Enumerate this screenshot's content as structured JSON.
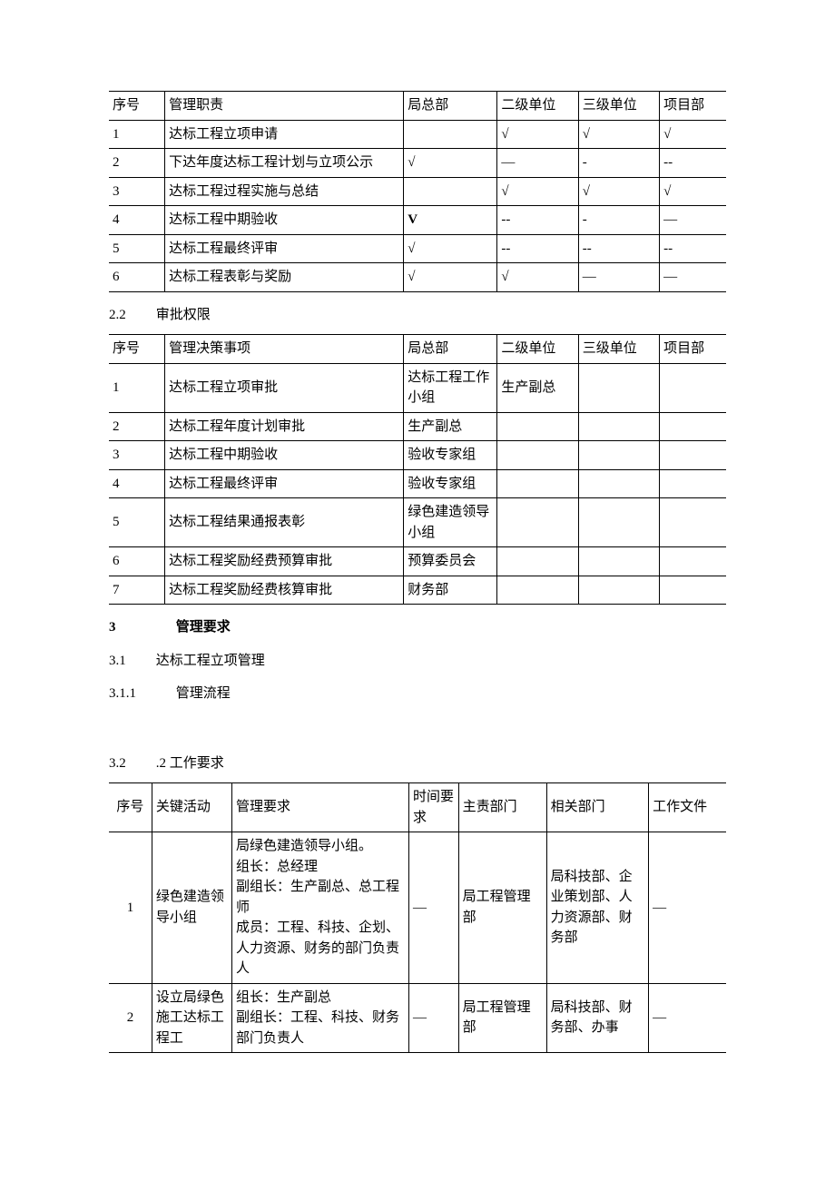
{
  "table1": {
    "headers": [
      "序号",
      "管理职责",
      "局总部",
      "二级单位",
      "三级单位",
      "项目部"
    ],
    "rows": [
      [
        "1",
        "达标工程立项申请",
        "",
        "√",
        "√",
        "√"
      ],
      [
        "2",
        "下达年度达标工程计划与立项公示",
        "√",
        "—",
        "-",
        "--"
      ],
      [
        "3",
        "达标工程过程实施与总结",
        "",
        "√",
        "√",
        "√"
      ],
      [
        "4",
        "达标工程中期验收",
        "V",
        "--",
        "-",
        "—"
      ],
      [
        "5",
        "达标工程最终评审",
        "√",
        "--",
        "--",
        "--"
      ],
      [
        "6",
        "达标工程表彰与奖励",
        "√",
        "√",
        "—",
        "—"
      ]
    ]
  },
  "sec22": {
    "num": "2.2",
    "title": "审批权限"
  },
  "table2": {
    "headers": [
      "序号",
      "管理决策事项",
      "局总部",
      "二级单位",
      "三级单位",
      "项目部"
    ],
    "rows": [
      [
        "1",
        "达标工程立项审批",
        "达标工程工作小组",
        "生产副总",
        "",
        ""
      ],
      [
        "2",
        "达标工程年度计划审批",
        "生产副总",
        "",
        "",
        ""
      ],
      [
        "3",
        "达标工程中期验收",
        "验收专家组",
        "",
        "",
        ""
      ],
      [
        "4",
        "达标工程最终评审",
        "验收专家组",
        "",
        "",
        ""
      ],
      [
        "5",
        "达标工程结果通报表彰",
        "绿色建造领导小组",
        "",
        "",
        ""
      ],
      [
        "6",
        "达标工程奖励经费预算审批",
        "预算委员会",
        "",
        "",
        ""
      ],
      [
        "7",
        "达标工程奖励经费核算审批",
        "财务部",
        "",
        "",
        ""
      ]
    ]
  },
  "sec3": {
    "num": "3",
    "title": "管理要求"
  },
  "sec31": {
    "num": "3.1",
    "title": "达标工程立项管理"
  },
  "sec311": {
    "num": "3.1.1",
    "title": "管理流程"
  },
  "sec32": {
    "num": "3.2",
    "title": ".2 工作要求"
  },
  "table3": {
    "headers": [
      "序号",
      "关键活动",
      "管理要求",
      "时间要求",
      "主责部门",
      "相关部门",
      "工作文件"
    ],
    "rows": [
      {
        "seq": "1",
        "activity": "绿色建造领导小组",
        "req": "局绿色建造领导小组。\n组长：总经理\n副组长：生产副总、总工程师\n成员：工程、科技、企划、人力资源、财务的部门负责人",
        "time": "—",
        "main": "局工程管理部",
        "rel": "局科技部、企业策划部、人力资源部、财务部",
        "file": "—"
      },
      {
        "seq": "2",
        "activity": "设立局绿色施工达标工程工",
        "req": "组长：生产副总\n副组长：工程、科技、财务部门负责人",
        "time": "—",
        "main": "局工程管理部",
        "rel": "局科技部、财务部、办事",
        "file": "—"
      }
    ]
  }
}
